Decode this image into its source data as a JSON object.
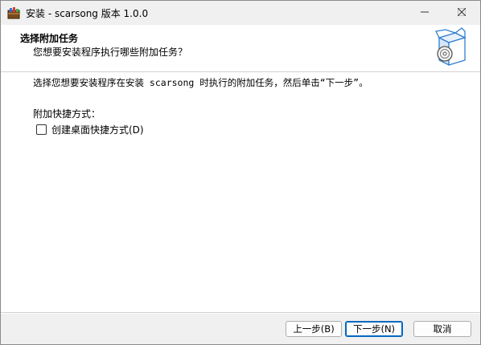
{
  "window": {
    "title": "安装 - scarsong 版本 1.0.0"
  },
  "header": {
    "title": "选择附加任务",
    "subtitle": "您想要安装程序执行哪些附加任务？",
    "icon": "installer-box-disc-icon"
  },
  "content": {
    "description": "选择您想要安装程序在安装 scarsong 时执行的附加任务，然后单击“下一步”。",
    "group_label": "附加快捷方式：",
    "tasks": [
      {
        "label": "创建桌面快捷方式(D)",
        "checked": false
      }
    ]
  },
  "buttons": {
    "back": "上一步(B)",
    "next": "下一步(N)",
    "cancel": "取消"
  },
  "colors": {
    "accent": "#0067c0"
  }
}
